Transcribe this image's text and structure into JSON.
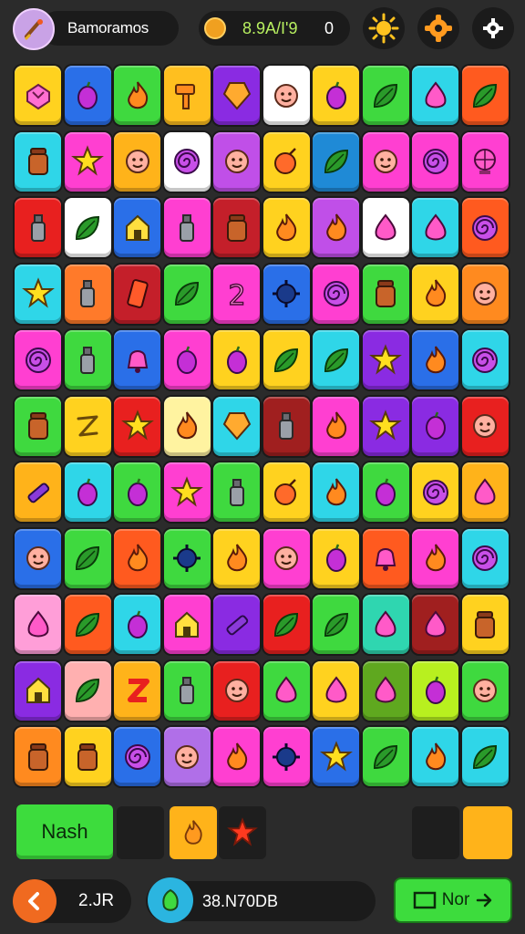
{
  "header": {
    "title": "Bamoramos",
    "coins_text": "8.9A/I'9",
    "coin_count": "0"
  },
  "tiles": [
    {
      "color": "#ffd21f",
      "icon": "heart-cube"
    },
    {
      "color": "#2a6fe8",
      "icon": "fruit"
    },
    {
      "color": "#3fd93f",
      "icon": "flame"
    },
    {
      "color": "#ffbf1f",
      "icon": "hammer"
    },
    {
      "color": "#8a2be2",
      "icon": "gem"
    },
    {
      "color": "#ffffff",
      "icon": "face"
    },
    {
      "color": "#ffd21f",
      "icon": "fruit"
    },
    {
      "color": "#3fd93f",
      "icon": "leaf"
    },
    {
      "color": "#2fd6e8",
      "icon": "drop"
    },
    {
      "color": "#ff5a1f",
      "icon": "leaf"
    },
    {
      "color": "#2fd6e8",
      "icon": "jar"
    },
    {
      "color": "#ff3fd1",
      "icon": "star"
    },
    {
      "color": "#ffb31a",
      "icon": "face"
    },
    {
      "color": "#ffffff",
      "icon": "swirl"
    },
    {
      "color": "#c04fe8",
      "icon": "face"
    },
    {
      "color": "#ffd21f",
      "icon": "bomb"
    },
    {
      "color": "#1f8ad6",
      "icon": "leaf"
    },
    {
      "color": "#ff3fd1",
      "icon": "face"
    },
    {
      "color": "#ff3fd1",
      "icon": "swirl"
    },
    {
      "color": "#ff3fd1",
      "icon": "globe"
    },
    {
      "color": "#e8201f",
      "icon": "bottle"
    },
    {
      "color": "#ffffff",
      "icon": "leaf"
    },
    {
      "color": "#2a6fe8",
      "icon": "house"
    },
    {
      "color": "#ff3fd1",
      "icon": "bottle"
    },
    {
      "color": "#c41f2a",
      "icon": "jar"
    },
    {
      "color": "#ffd21f",
      "icon": "flame"
    },
    {
      "color": "#c04fe8",
      "icon": "flame"
    },
    {
      "color": "#ffffff",
      "icon": "drop"
    },
    {
      "color": "#2fd6e8",
      "icon": "drop"
    },
    {
      "color": "#ff5a1f",
      "icon": "swirl"
    },
    {
      "color": "#2fd6e8",
      "icon": "star"
    },
    {
      "color": "#ff7a2a",
      "icon": "bottle"
    },
    {
      "color": "#c41f2a",
      "icon": "bar"
    },
    {
      "color": "#3fd93f",
      "icon": "leaf"
    },
    {
      "color": "#ff3fd1",
      "icon": "two"
    },
    {
      "color": "#2a6fe8",
      "icon": "gear"
    },
    {
      "color": "#ff3fd1",
      "icon": "swirl"
    },
    {
      "color": "#3fd93f",
      "icon": "jar"
    },
    {
      "color": "#ffd21f",
      "icon": "flame"
    },
    {
      "color": "#ff8a1f",
      "icon": "face"
    },
    {
      "color": "#ff3fd1",
      "icon": "swirl"
    },
    {
      "color": "#3fd93f",
      "icon": "bottle"
    },
    {
      "color": "#2a6fe8",
      "icon": "bell"
    },
    {
      "color": "#ff3fd1",
      "icon": "fruit"
    },
    {
      "color": "#ffd21f",
      "icon": "fruit"
    },
    {
      "color": "#ffd21f",
      "icon": "leaf"
    },
    {
      "color": "#2fd6e8",
      "icon": "leaf"
    },
    {
      "color": "#8a2be2",
      "icon": "star"
    },
    {
      "color": "#2a6fe8",
      "icon": "flame"
    },
    {
      "color": "#2fd6e8",
      "icon": "swirl"
    },
    {
      "color": "#3fd93f",
      "icon": "jar"
    },
    {
      "color": "#ffd21f",
      "icon": "squiggle"
    },
    {
      "color": "#e8201f",
      "icon": "star"
    },
    {
      "color": "#fff3a0",
      "icon": "flame"
    },
    {
      "color": "#2fd6e8",
      "icon": "gem"
    },
    {
      "color": "#a01f1f",
      "icon": "bottle"
    },
    {
      "color": "#ff3fd1",
      "icon": "flame"
    },
    {
      "color": "#8a2be2",
      "icon": "star"
    },
    {
      "color": "#8a2be2",
      "icon": "fruit"
    },
    {
      "color": "#e8201f",
      "icon": "face"
    },
    {
      "color": "#ffb31a",
      "icon": "crayon"
    },
    {
      "color": "#2fd6e8",
      "icon": "fruit"
    },
    {
      "color": "#3fd93f",
      "icon": "fruit"
    },
    {
      "color": "#ff3fd1",
      "icon": "star"
    },
    {
      "color": "#3fd93f",
      "icon": "bottle"
    },
    {
      "color": "#ffd21f",
      "icon": "bomb"
    },
    {
      "color": "#2fd6e8",
      "icon": "flame"
    },
    {
      "color": "#3fd93f",
      "icon": "fruit"
    },
    {
      "color": "#ffd21f",
      "icon": "swirl"
    },
    {
      "color": "#ffb31a",
      "icon": "drop"
    },
    {
      "color": "#2a6fe8",
      "icon": "face"
    },
    {
      "color": "#3fd93f",
      "icon": "leaf"
    },
    {
      "color": "#ff5a1f",
      "icon": "flame"
    },
    {
      "color": "#3fd93f",
      "icon": "gear"
    },
    {
      "color": "#ffd21f",
      "icon": "flame"
    },
    {
      "color": "#ff3fd1",
      "icon": "face"
    },
    {
      "color": "#ffd21f",
      "icon": "fruit"
    },
    {
      "color": "#ff5a1f",
      "icon": "bell"
    },
    {
      "color": "#ff3fd1",
      "icon": "flame"
    },
    {
      "color": "#2fd6e8",
      "icon": "swirl"
    },
    {
      "color": "#ff9ed8",
      "icon": "drop"
    },
    {
      "color": "#ff5a1f",
      "icon": "leaf"
    },
    {
      "color": "#2fd6e8",
      "icon": "fruit"
    },
    {
      "color": "#ff3fd1",
      "icon": "house"
    },
    {
      "color": "#8a2be2",
      "icon": "crayon"
    },
    {
      "color": "#e8201f",
      "icon": "leaf"
    },
    {
      "color": "#3fd93f",
      "icon": "leaf"
    },
    {
      "color": "#2fd6b0",
      "icon": "drop"
    },
    {
      "color": "#a01f1f",
      "icon": "drop"
    },
    {
      "color": "#ffd21f",
      "icon": "jar"
    },
    {
      "color": "#8a2be2",
      "icon": "house"
    },
    {
      "color": "#ffb0b0",
      "icon": "leaf"
    },
    {
      "color": "#ffb31a",
      "icon": "zigzag"
    },
    {
      "color": "#3fd93f",
      "icon": "bottle"
    },
    {
      "color": "#e8201f",
      "icon": "face"
    },
    {
      "color": "#3fd93f",
      "icon": "drop"
    },
    {
      "color": "#ffd21f",
      "icon": "drop"
    },
    {
      "color": "#5fa81f",
      "icon": "drop"
    },
    {
      "color": "#b8f01f",
      "icon": "fruit"
    },
    {
      "color": "#3fd93f",
      "icon": "face"
    },
    {
      "color": "#ff8a1f",
      "icon": "jar"
    },
    {
      "color": "#ffd21f",
      "icon": "jar"
    },
    {
      "color": "#2a6fe8",
      "icon": "swirl"
    },
    {
      "color": "#b06fe8",
      "icon": "face"
    },
    {
      "color": "#ff3fd1",
      "icon": "flame"
    },
    {
      "color": "#ff3fd1",
      "icon": "gear"
    },
    {
      "color": "#2a6fe8",
      "icon": "star"
    },
    {
      "color": "#3fd93f",
      "icon": "leaf"
    },
    {
      "color": "#2fd6e8",
      "icon": "flame"
    },
    {
      "color": "#2fd6e8",
      "icon": "leaf"
    }
  ],
  "tray": {
    "button_label": "Nash",
    "slots": [
      {
        "filled": false,
        "icon": ""
      },
      {
        "filled": true,
        "color": "#ffb31a",
        "icon": "flame"
      },
      {
        "filled": false,
        "icon": "star-red"
      },
      {
        "filled": false,
        "icon": ""
      },
      {
        "filled": true,
        "color": "#ffb31a",
        "icon": ""
      }
    ]
  },
  "footer": {
    "back_label": "2.JR",
    "score_text": "38.N70DB",
    "next_label": "Nor"
  },
  "icons": {
    "avatar": "brush-icon",
    "coin": "coin-icon",
    "sun": "sun-icon",
    "settings": "gear-icon",
    "options": "cog-icon",
    "back": "chevron-left-icon",
    "score": "gem-icon",
    "next": "arrow-right-icon"
  }
}
